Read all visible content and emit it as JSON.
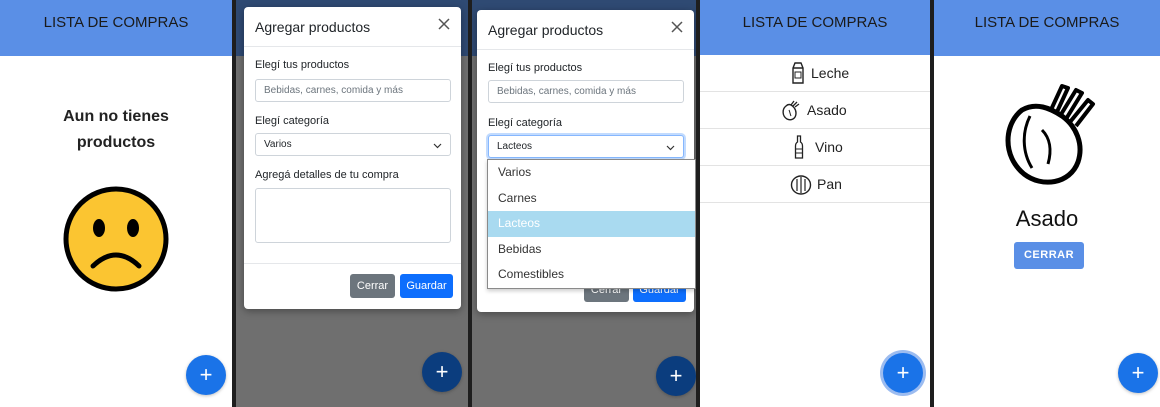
{
  "app": {
    "header_title": "LISTA DE COMPRAS",
    "fab_label": "+"
  },
  "empty_state": {
    "line1": "Aun no tienes",
    "line2": "productos"
  },
  "modal": {
    "title": "Agregar productos",
    "products_label": "Elegí tus productos",
    "products_placeholder": "Bebidas, carnes, comida y más",
    "category_label": "Elegí categoría",
    "category_value_default": "Varios",
    "category_value_open": "Lacteos",
    "details_label": "Agregá detalles de tu compra",
    "cancel_label": "Cerrar",
    "save_label": "Guardar"
  },
  "dropdown": {
    "options": [
      "Varios",
      "Carnes",
      "Lacteos",
      "Bebidas",
      "Comestibles"
    ],
    "selected": "Lacteos"
  },
  "list": {
    "items": [
      {
        "label": "Leche",
        "icon": "milk-carton-icon"
      },
      {
        "label": "Asado",
        "icon": "meat-icon"
      },
      {
        "label": "Vino",
        "icon": "wine-bottle-icon"
      },
      {
        "label": "Pan",
        "icon": "bread-icon"
      }
    ]
  },
  "detail": {
    "title": "Asado",
    "close_label": "CERRAR",
    "icon": "meat-icon"
  },
  "colors": {
    "header": "#5a8fe6",
    "fab": "#1a73e8",
    "primary_button": "#0d6efd",
    "secondary_button": "#6c757d",
    "dropdown_selected": "#a9daf0",
    "sad_face": "#fbc531"
  }
}
